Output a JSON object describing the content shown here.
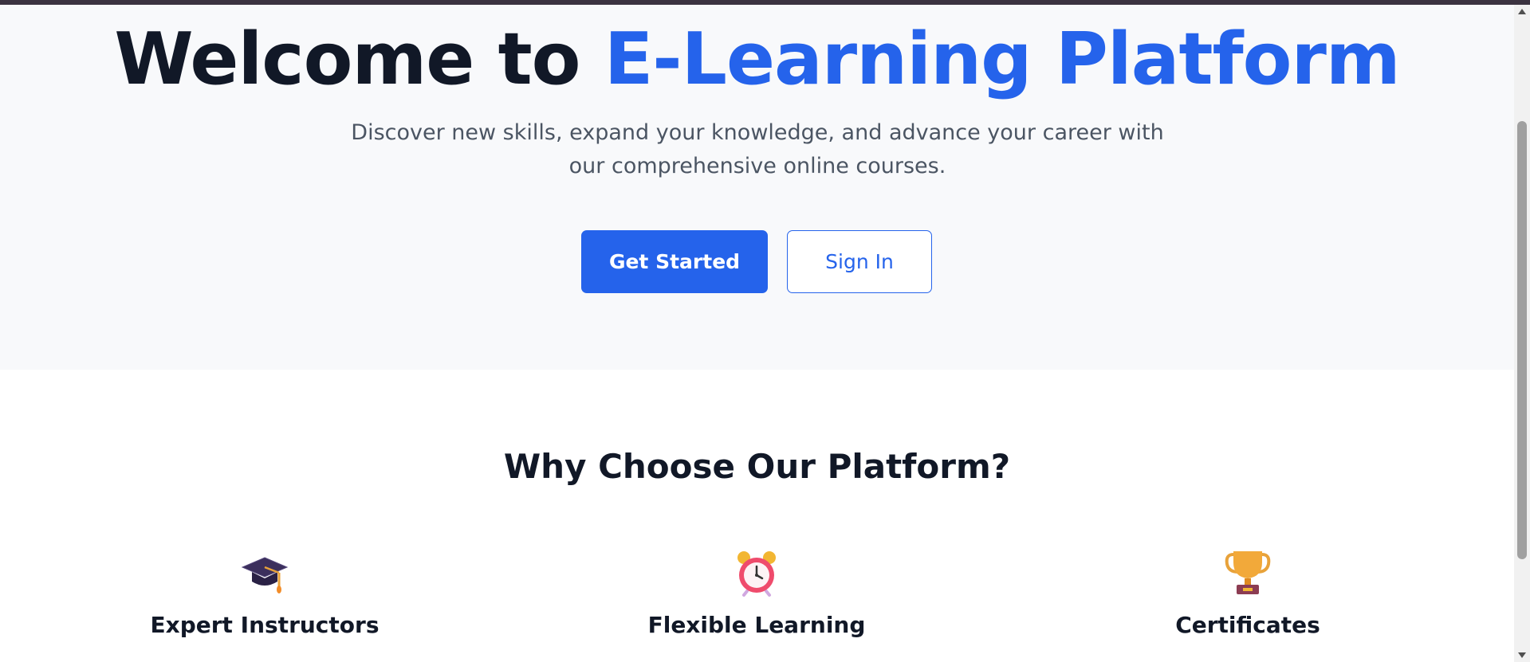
{
  "hero": {
    "title_prefix": "Welcome to ",
    "title_accent": "E-Learning Platform",
    "subtitle": "Discover new skills, expand your knowledge, and advance your career with our comprehensive online courses.",
    "primary_button": "Get Started",
    "secondary_button": "Sign In"
  },
  "features": {
    "heading": "Why Choose Our Platform?",
    "items": [
      {
        "icon": "graduation-cap-icon",
        "label": "Expert Instructors"
      },
      {
        "icon": "alarm-clock-icon",
        "label": "Flexible Learning"
      },
      {
        "icon": "trophy-icon",
        "label": "Certificates"
      }
    ]
  },
  "colors": {
    "accent": "#2563eb",
    "heading": "#111827",
    "body_text": "#4b5563",
    "hero_bg": "#f8f9fb"
  }
}
